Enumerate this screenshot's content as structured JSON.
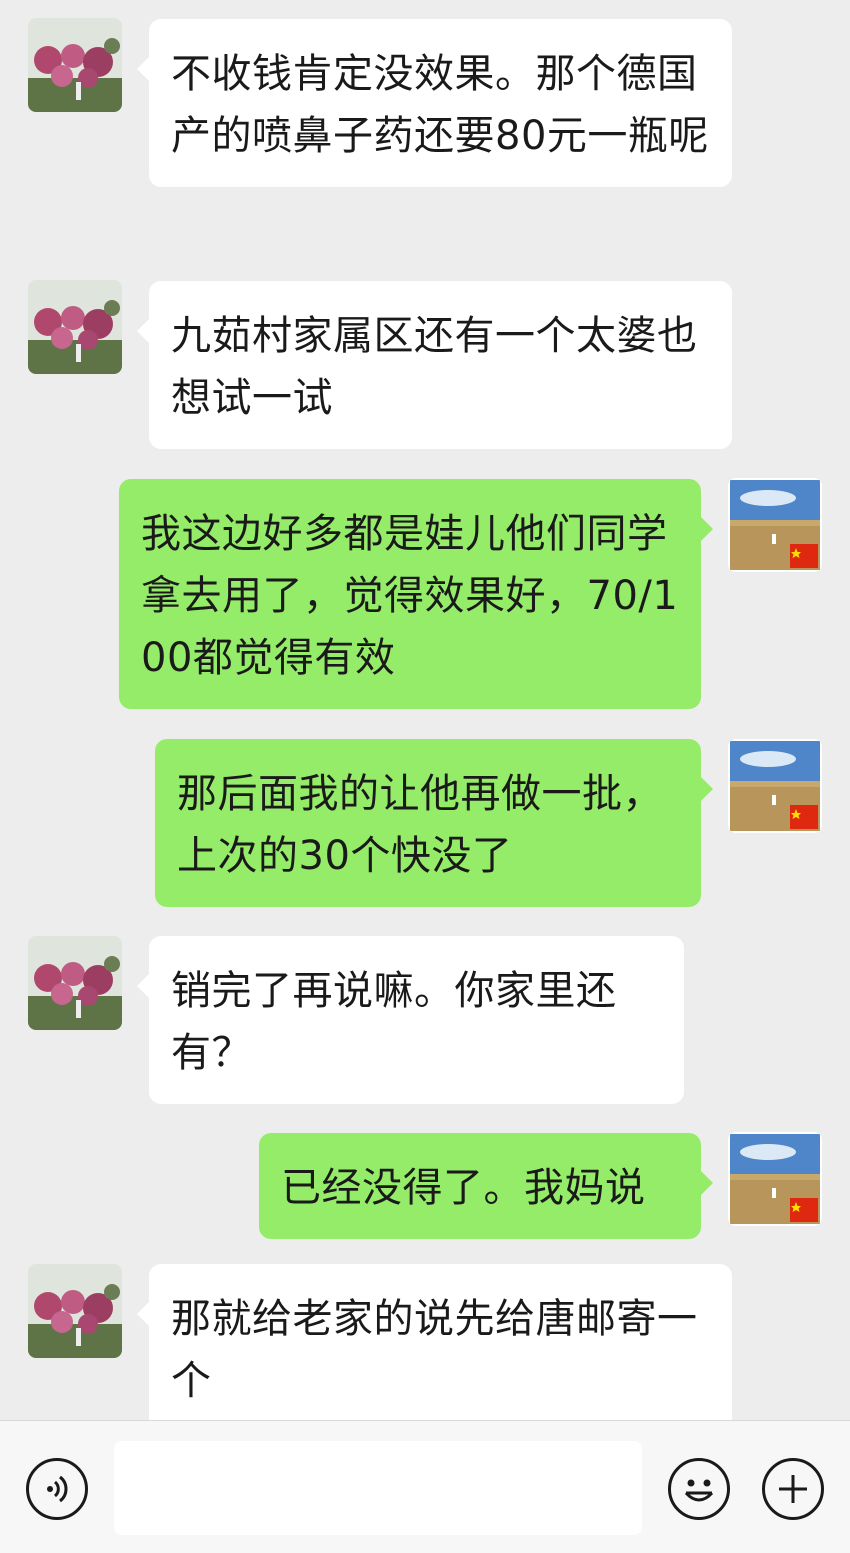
{
  "messages": [
    {
      "side": "in",
      "text": "不收钱肯定没效果。那个德国产的喷鼻子药还要80元一瓶呢"
    },
    {
      "side": "in",
      "text": "九茹村家属区还有一个太婆也想试一试"
    },
    {
      "side": "out",
      "text": "我这边好多都是娃儿他们同学拿去用了，觉得效果好，70/100都觉得有效"
    },
    {
      "side": "out",
      "text": "那后面我的让他再做一批，上次的30个快没了"
    },
    {
      "side": "in",
      "text": "销完了再说嘛。你家里还有？"
    },
    {
      "side": "out",
      "text": "已经没得了。我妈说"
    },
    {
      "side": "in",
      "text": "那就给老家的说先给唐邮寄一个"
    }
  ],
  "input_bar": {
    "voice_icon": "voice-icon",
    "text_value": "",
    "emoji_icon": "emoji-icon",
    "plus_icon": "plus-icon"
  },
  "colors": {
    "background": "#ededed",
    "incoming_bubble": "#ffffff",
    "outgoing_bubble": "#95ec69",
    "bottom_bar": "#f7f7f7"
  }
}
